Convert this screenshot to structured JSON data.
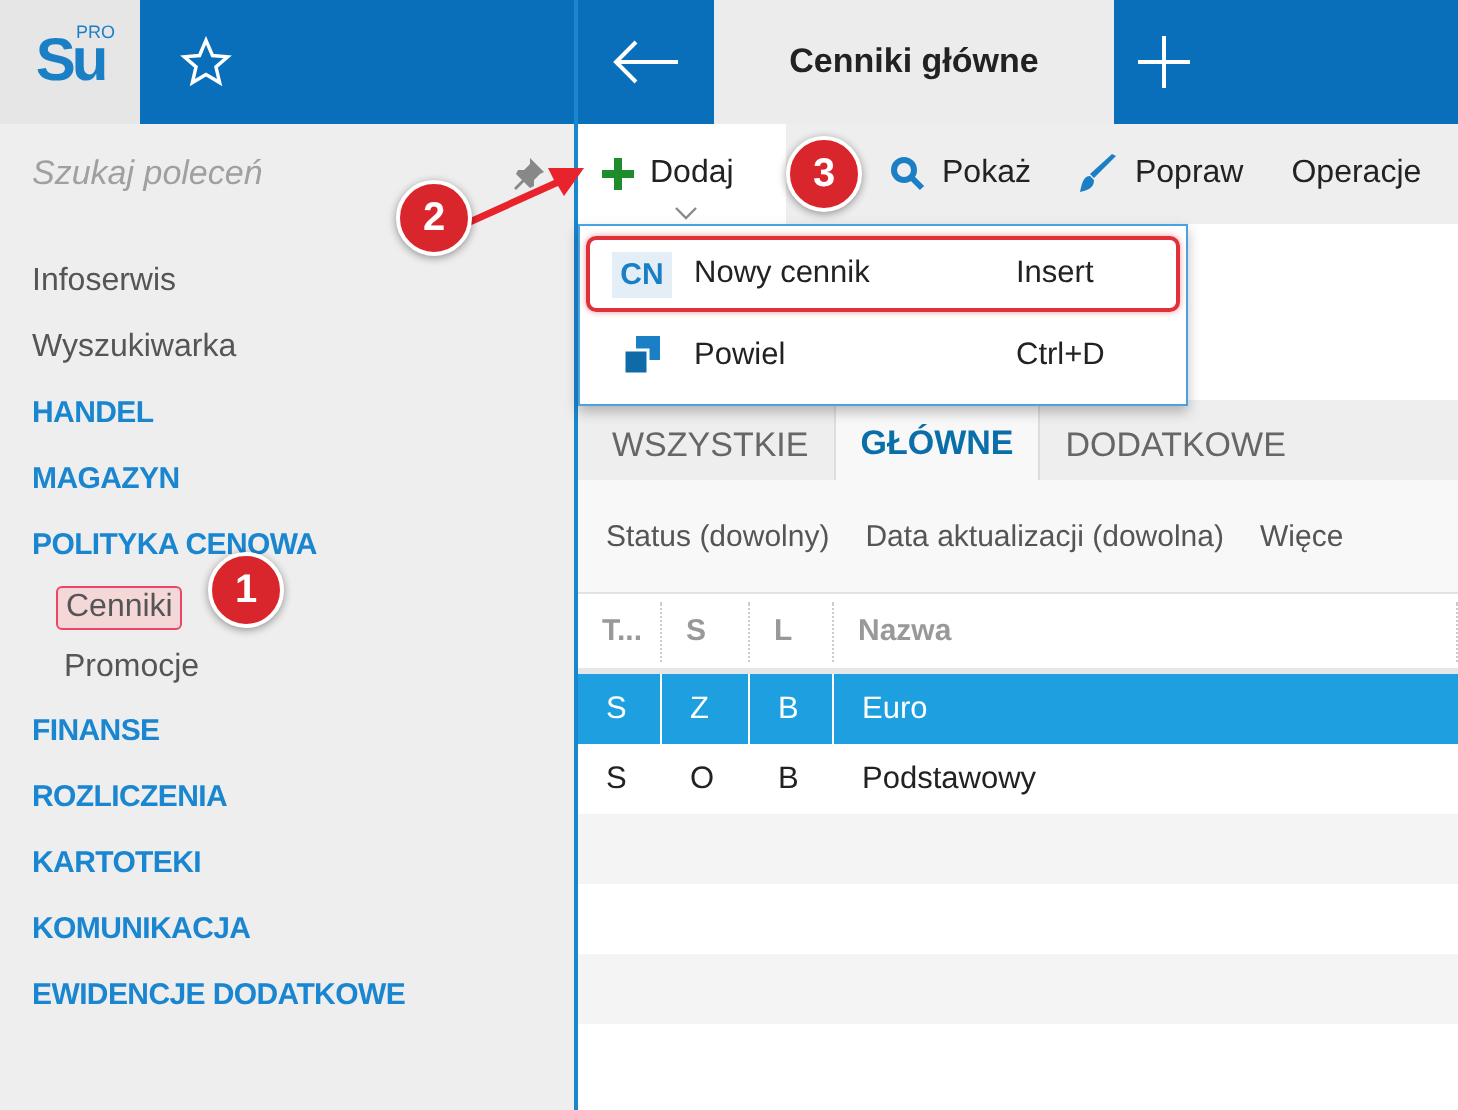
{
  "header": {
    "logo": "Su",
    "logo_badge": "PRO",
    "tab_title": "Cenniki główne"
  },
  "search": {
    "placeholder": "Szukaj poleceń"
  },
  "sidebar": {
    "items": [
      {
        "label": "Infoserwis",
        "kind": "link"
      },
      {
        "label": "Wyszukiwarka",
        "kind": "link"
      },
      {
        "label": "HANDEL",
        "kind": "section"
      },
      {
        "label": "MAGAZYN",
        "kind": "section"
      },
      {
        "label": "POLITYKA CENOWA",
        "kind": "section",
        "children": [
          {
            "label": "Cenniki",
            "highlighted": true
          },
          {
            "label": "Promocje",
            "highlighted": false
          }
        ]
      },
      {
        "label": "FINANSE",
        "kind": "section"
      },
      {
        "label": "ROZLICZENIA",
        "kind": "section"
      },
      {
        "label": "KARTOTEKI",
        "kind": "section"
      },
      {
        "label": "KOMUNIKACJA",
        "kind": "section"
      },
      {
        "label": "EWIDENCJE DODATKOWE",
        "kind": "section"
      }
    ]
  },
  "toolbar": [
    {
      "label": "Dodaj",
      "kind": "add"
    },
    {
      "label": "Pokaż",
      "kind": "show"
    },
    {
      "label": "Popraw",
      "kind": "edit"
    },
    {
      "label": "Operacje",
      "kind": "text"
    }
  ],
  "menu": [
    {
      "icon_text": "CN",
      "label": "Nowy cennik",
      "shortcut": "Insert",
      "highlighted": true
    },
    {
      "label": "Powiel",
      "shortcut": "Ctrl+D",
      "highlighted": false
    }
  ],
  "tabs": [
    {
      "label": "WSZYSTKIE",
      "selected": false
    },
    {
      "label": "GŁÓWNE",
      "selected": true
    },
    {
      "label": "DODATKOWE",
      "selected": false
    }
  ],
  "filters": [
    "Status (dowolny)",
    "Data aktualizacji (dowolna)",
    "Więce"
  ],
  "table": {
    "columns": [
      "T...",
      "S",
      "L",
      "Nazwa"
    ],
    "rows": [
      {
        "cells": [
          "S",
          "Z",
          "B",
          "Euro"
        ],
        "selected": true
      },
      {
        "cells": [
          "S",
          "O",
          "B",
          "Podstawowy"
        ],
        "selected": false
      }
    ]
  },
  "annotations": [
    "1",
    "2",
    "3"
  ]
}
